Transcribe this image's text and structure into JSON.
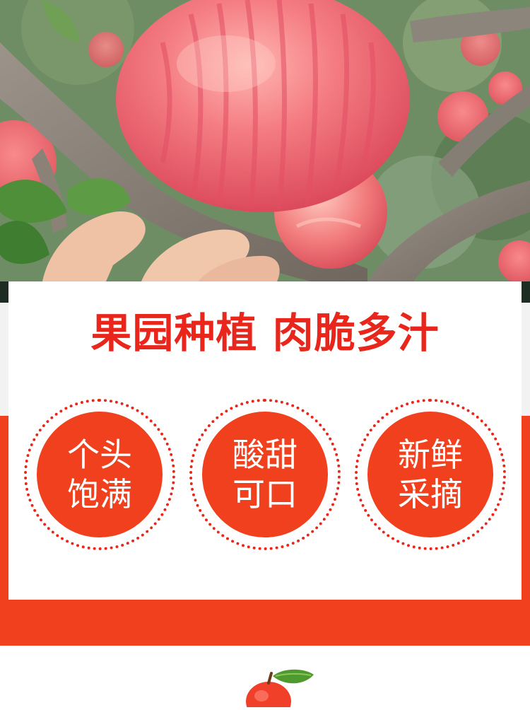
{
  "photo": {
    "subject": "red-striped-apples-on-branch"
  },
  "banner": {
    "headline": "果园种植 肉脆多汁",
    "features": [
      {
        "text": "个头饱满"
      },
      {
        "text": "酸甜可口"
      },
      {
        "text": "新鲜采摘"
      }
    ]
  },
  "colors": {
    "accent_red": "#e8261c",
    "orange_red": "#f0401e",
    "apple_pink": "#f25a6a",
    "leaf_green": "#4f8f3a"
  },
  "footer": {
    "icon": "apple-icon"
  }
}
